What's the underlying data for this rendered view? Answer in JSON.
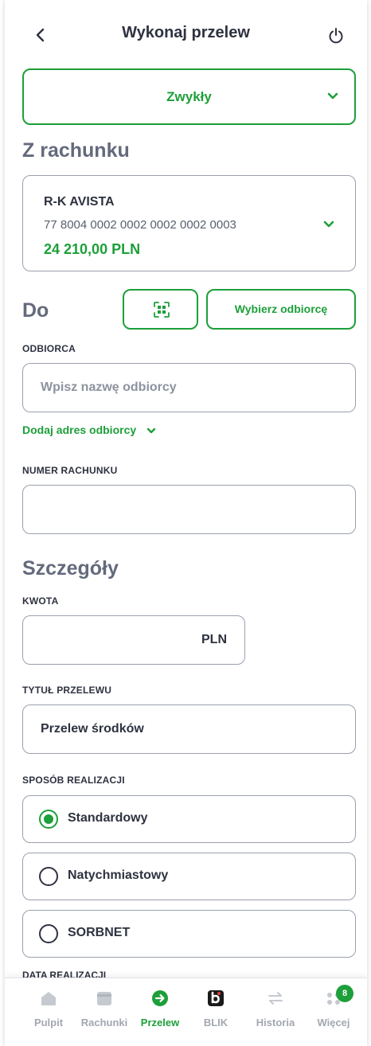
{
  "header": {
    "title": "Wykonaj przelew",
    "back_icon": "chevron-left-icon",
    "power_icon": "power-icon"
  },
  "transfer_type": {
    "value": "Zwykły"
  },
  "from_section": {
    "title": "Z rachunku",
    "account_name": "R-K AVISTA",
    "account_number": "77 8004 0002 0002 0002 0002 0003",
    "balance": "24 210,00 PLN"
  },
  "to_section": {
    "title": "Do",
    "qr_icon": "qr-scan-icon",
    "pick_recipient_label": "Wybierz odbiorcę",
    "recipient_label": "ODBIORCA",
    "recipient_placeholder": "Wpisz nazwę odbiorcy",
    "add_address_label": "Dodaj adres odbiorcy",
    "account_number_label": "NUMER RACHUNKU",
    "account_number_value": ""
  },
  "details_section": {
    "title": "Szczegóły",
    "amount_label": "KWOTA",
    "amount_value": "",
    "currency": "PLN",
    "transfer_title_label": "TYTUŁ PRZELEWU",
    "transfer_title_value": "Przelew środków",
    "method_label": "SPOSÓB REALIZACJI",
    "methods": [
      {
        "label": "Standardowy",
        "selected": true
      },
      {
        "label": "Natychmiastowy",
        "selected": false
      },
      {
        "label": "SORBNET",
        "selected": false
      }
    ],
    "date_label_partial": "DATA REALIZACJI"
  },
  "bottom_nav": {
    "items": [
      {
        "label": "Pulpit",
        "icon": "home-icon",
        "active": false
      },
      {
        "label": "Rachunki",
        "icon": "wallet-icon",
        "active": false
      },
      {
        "label": "Przelew",
        "icon": "arrow-right-circle-icon",
        "active": true
      },
      {
        "label": "BLIK",
        "icon": "blik-icon",
        "active": false
      },
      {
        "label": "Historia",
        "icon": "swap-arrows-icon",
        "active": false
      },
      {
        "label": "Więcej",
        "icon": "more-dots-icon",
        "active": false
      }
    ],
    "more_badge": "8"
  },
  "colors": {
    "accent": "#1d9f3a",
    "text": "#2e3240",
    "muted": "#a3a7b1",
    "border": "#9aa0ad"
  }
}
